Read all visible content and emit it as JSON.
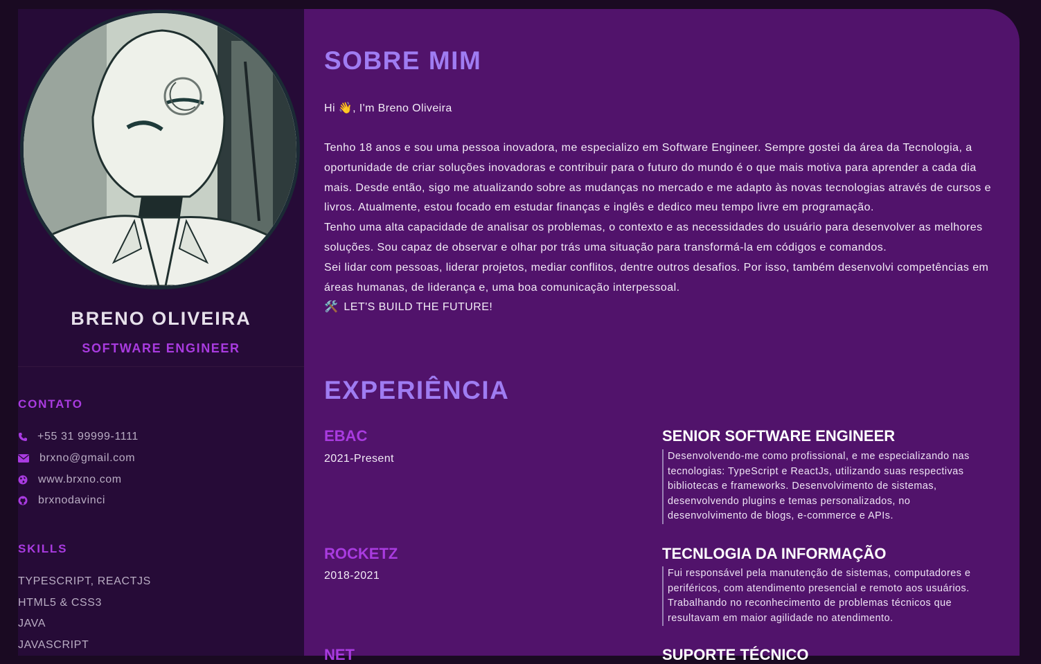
{
  "profile": {
    "name": "BRENO OLIVEIRA",
    "role": "SOFTWARE ENGINEER"
  },
  "contact": {
    "title": "CONTATO",
    "items": [
      {
        "icon": "phone-icon",
        "text": "+55 31 99999-1111"
      },
      {
        "icon": "envelope-icon",
        "text": "brxno@gmail.com"
      },
      {
        "icon": "globe-icon",
        "text": "www.brxno.com"
      },
      {
        "icon": "github-icon",
        "text": "brxnodavinci"
      }
    ]
  },
  "skills": {
    "title": "SKILLS",
    "items": [
      "TYPESCRIPT, REACTJS",
      "HTML5 & CSS3",
      "JAVA",
      "JAVASCRIPT"
    ]
  },
  "about": {
    "title": "SOBRE MIM",
    "greeting": "Hi 👋, I'm Breno Oliveira",
    "paragraphs": [
      "Tenho 18 anos e sou uma pessoa inovadora, me especializo em Software Engineer. Sempre gostei da área da Tecnologia, a oportunidade de criar soluções inovadoras e contribuir para o futuro do mundo é o que mais motiva para aprender a cada dia mais. Desde então, sigo me atualizando sobre as mudanças no mercado e me adapto às novas tecnologias através de cursos e livros. Atualmente, estou focado em estudar finanças e inglês e dedico meu tempo livre em programação.",
      "Tenho uma alta capacidade de analisar os problemas, o contexto e as necessidades do usuário para desenvolver as melhores soluções. Sou capaz de observar e olhar por trás uma situação para transformá-la em códigos e comandos.",
      "Sei lidar com pessoas, liderar projetos, mediar conflitos, dentre outros desafios. Por isso, também desenvolvi competências em áreas humanas, de liderança e, uma boa comunicação interpessoal."
    ],
    "closing_icon": "🛠️",
    "closing": "LET'S BUILD THE FUTURE!"
  },
  "experience": {
    "title": "EXPERIÊNCIA",
    "items": [
      {
        "company": "EBAC",
        "period": "2021-Present",
        "role": "SENIOR SOFTWARE ENGINEER",
        "description": "Desenvolvendo-me como profissional, e me especializando nas tecnologias: TypeScript e ReactJs, utilizando suas respectivas bibliotecas e frameworks. Desenvolvimento de sistemas, desenvolvendo plugins e temas personalizados, no desenvolvimento de blogs, e-commerce e APIs."
      },
      {
        "company": "ROCKETZ",
        "period": "2018-2021",
        "role": "TECNLOGIA DA INFORMAÇÃO",
        "description": "Fui responsável pela manutenção de sistemas, computadores e periféricos, com atendimento presencial e remoto aos usuários. Trabalhando no reconhecimento de problemas técnicos que resultavam em maior agilidade no atendimento."
      },
      {
        "company": "NET",
        "role": "SUPORTE TÉCNICO"
      }
    ]
  },
  "colors": {
    "page_bg": "#1a0a22",
    "sidebar_bg": "#260b37",
    "main_bg": "#51136b",
    "accent": "#a93be0",
    "heading": "#9f7cf2"
  }
}
